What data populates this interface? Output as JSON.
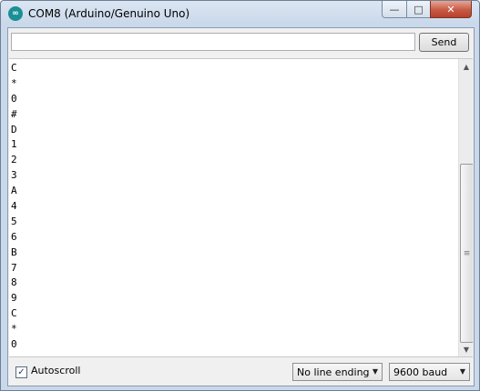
{
  "window": {
    "title": "COM8 (Arduino/Genuino Uno)",
    "controls": {
      "minimize": "—",
      "maximize": "□",
      "close": "✕"
    }
  },
  "send_bar": {
    "input_value": "",
    "send_label": "Send"
  },
  "output": {
    "lines": [
      "C",
      "*",
      "0",
      "#",
      "D",
      "1",
      "2",
      "3",
      "A",
      "4",
      "5",
      "6",
      "B",
      "7",
      "8",
      "9",
      "C",
      "*",
      "0"
    ]
  },
  "scrollbar": {
    "up_icon": "▲",
    "down_icon": "▼",
    "grip": "≡"
  },
  "footer": {
    "autoscroll_label": "Autoscroll",
    "autoscroll_checked": true,
    "checkmark": "✓",
    "line_ending_value": "No line ending",
    "baud_value": "9600 baud",
    "dropdown_icon": "▼"
  }
}
